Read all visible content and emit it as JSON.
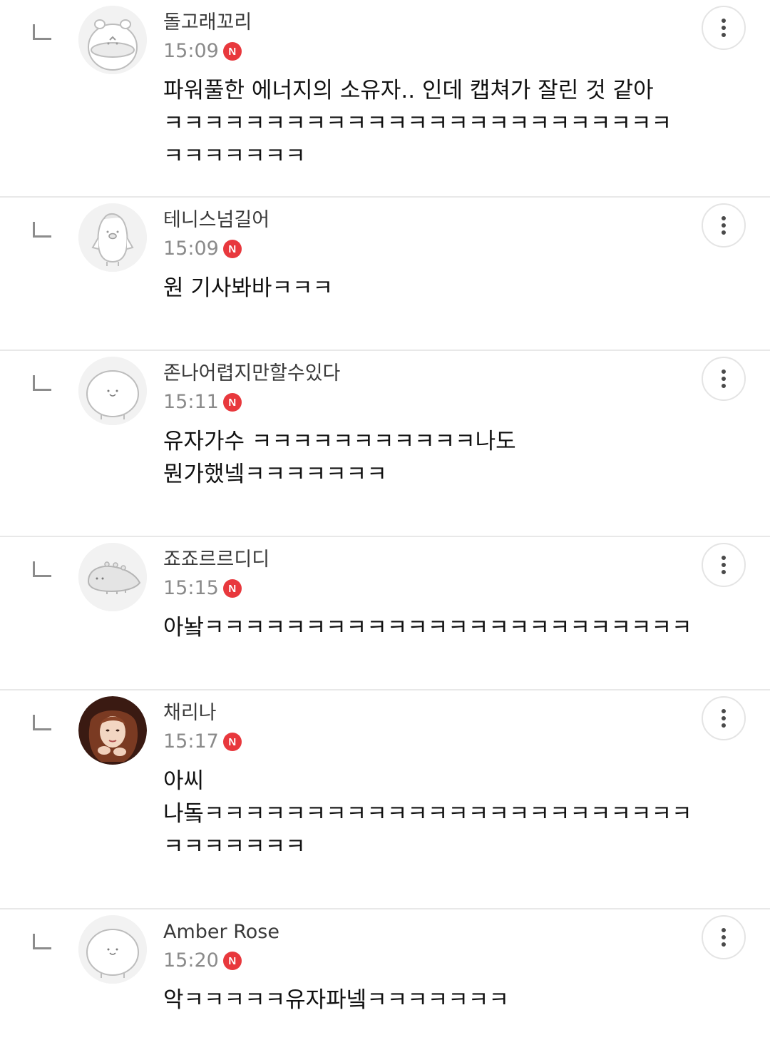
{
  "comments": [
    {
      "author": "돌고래꼬리",
      "time": "15:09",
      "badge": "N",
      "avatar": "hamster-avatar",
      "lines": [
        "파워풀한 에너지의 소유자.. 인데 캡쳐가 잘린 것 같아",
        "ㅋㅋㅋㅋㅋㅋㅋㅋㅋㅋㅋㅋㅋㅋㅋㅋㅋㅋㅋㅋㅋㅋㅋㅋㅋ",
        "ㅋㅋㅋㅋㅋㅋㅋ"
      ]
    },
    {
      "author": "테니스넘길어",
      "time": "15:09",
      "badge": "N",
      "avatar": "penguin-avatar",
      "lines": [
        "원 기사봐바ㅋㅋㅋ"
      ]
    },
    {
      "author": "존나어렵지만할수있다",
      "time": "15:11",
      "badge": "N",
      "avatar": "blob-avatar",
      "lines": [
        "유자가수 ㅋㅋㅋㅋㅋㅋㅋㅋㅋㅋㅋ나도",
        "뭔가했넼ㅋㅋㅋㅋㅋㅋㅋ"
      ]
    },
    {
      "author": "죠죠르르디디",
      "time": "15:15",
      "badge": "N",
      "avatar": "dino-avatar",
      "lines": [
        "아놬ㅋㅋㅋㅋㅋㅋㅋㅋㅋㅋㅋㅋㅋㅋㅋㅋㅋㅋㅋㅋㅋㅋㅋㅋ"
      ]
    },
    {
      "author": "채리나",
      "time": "15:17",
      "badge": "N",
      "avatar": "photo-avatar",
      "lines": [
        "아씨",
        "나돜ㅋㅋㅋㅋㅋㅋㅋㅋㅋㅋㅋㅋㅋㅋㅋㅋㅋㅋㅋㅋㅋㅋㅋㅋ",
        "ㅋㅋㅋㅋㅋㅋㅋ"
      ]
    },
    {
      "author": "Amber Rose",
      "time": "15:20",
      "badge": "N",
      "avatar": "blob-avatar",
      "lines": [
        "악ㅋㅋㅋㅋㅋ유자파넼ㅋㅋㅋㅋㅋㅋㅋ"
      ]
    }
  ],
  "colors": {
    "badge": "#e8383d",
    "divider": "#e8e8e8",
    "time": "#8a8a8a",
    "author": "#3a3a3a"
  }
}
